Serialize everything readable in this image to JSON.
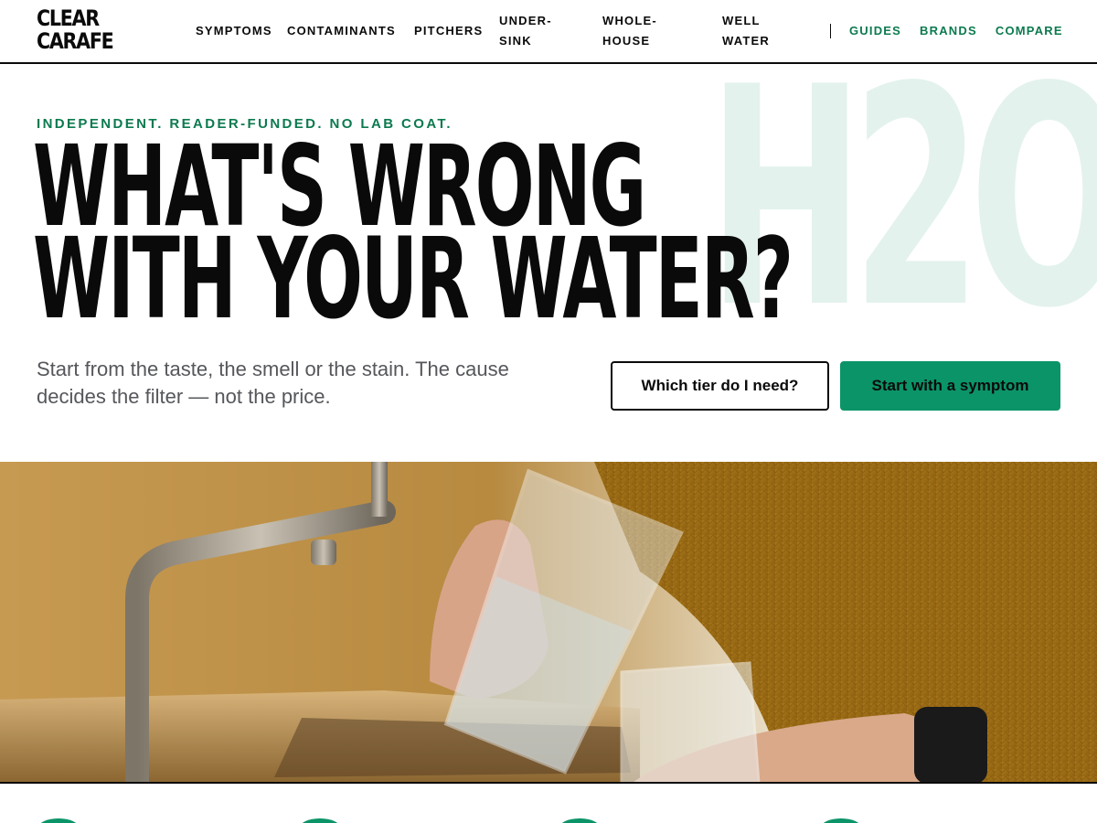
{
  "logo": {
    "line1": "CLEAR",
    "line2": "CARAFE"
  },
  "nav": {
    "main": [
      {
        "label": "SYMPTOMS"
      },
      {
        "label": "CONTAMINANTS"
      },
      {
        "label": "PITCHERS"
      },
      {
        "label": "UNDER-\nSINK"
      },
      {
        "label": "WHOLE-\nHOUSE"
      },
      {
        "label": "WELL\nWATER"
      }
    ],
    "secondary": [
      {
        "label": "GUIDES"
      },
      {
        "label": "BRANDS"
      },
      {
        "label": "COMPARE"
      }
    ]
  },
  "hero": {
    "watermark": "H2O",
    "eyebrow": "INDEPENDENT. READER-FUNDED. NO LAB COAT.",
    "headline_line1": "WHAT'S WRONG",
    "headline_line2": "WITH YOUR WATER?",
    "lede": "Start from the taste, the smell or the stain. The cause decides the filter — not the price.",
    "secondary_cta": "Which tier do I need?",
    "primary_cta": "Start with a symptom"
  },
  "colors": {
    "accent": "#0b9468",
    "accent_text": "#0c7a4f",
    "watermark": "#e3f2ec",
    "ink": "#0a0a0a",
    "muted": "#55575b"
  }
}
